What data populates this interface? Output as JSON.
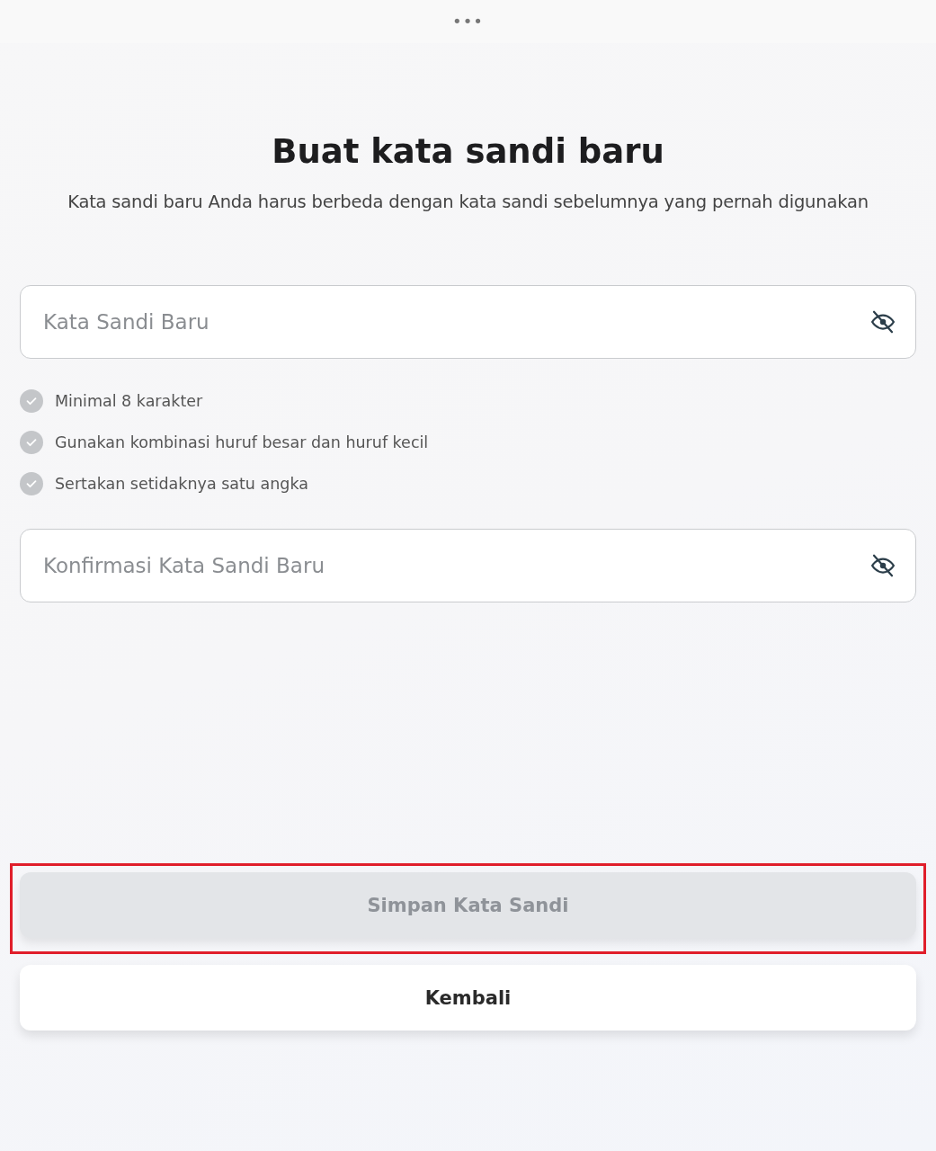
{
  "header": {
    "menu": "•••"
  },
  "title": "Buat kata sandi baru",
  "subtitle": "Kata sandi baru Anda harus berbeda dengan kata sandi sebelumnya yang pernah digunakan",
  "new_password": {
    "placeholder": "Kata Sandi Baru"
  },
  "requirements": [
    {
      "label": "Minimal 8 karakter",
      "met": false
    },
    {
      "label": "Gunakan kombinasi huruf besar dan huruf kecil",
      "met": false
    },
    {
      "label": "Sertakan setidaknya satu angka",
      "met": false
    }
  ],
  "confirm_password": {
    "placeholder": "Konfirmasi Kata Sandi Baru"
  },
  "save_button": {
    "label": "Simpan Kata Sandi",
    "disabled": true,
    "highlighted": true
  },
  "back_button": {
    "label": "Kembali"
  }
}
